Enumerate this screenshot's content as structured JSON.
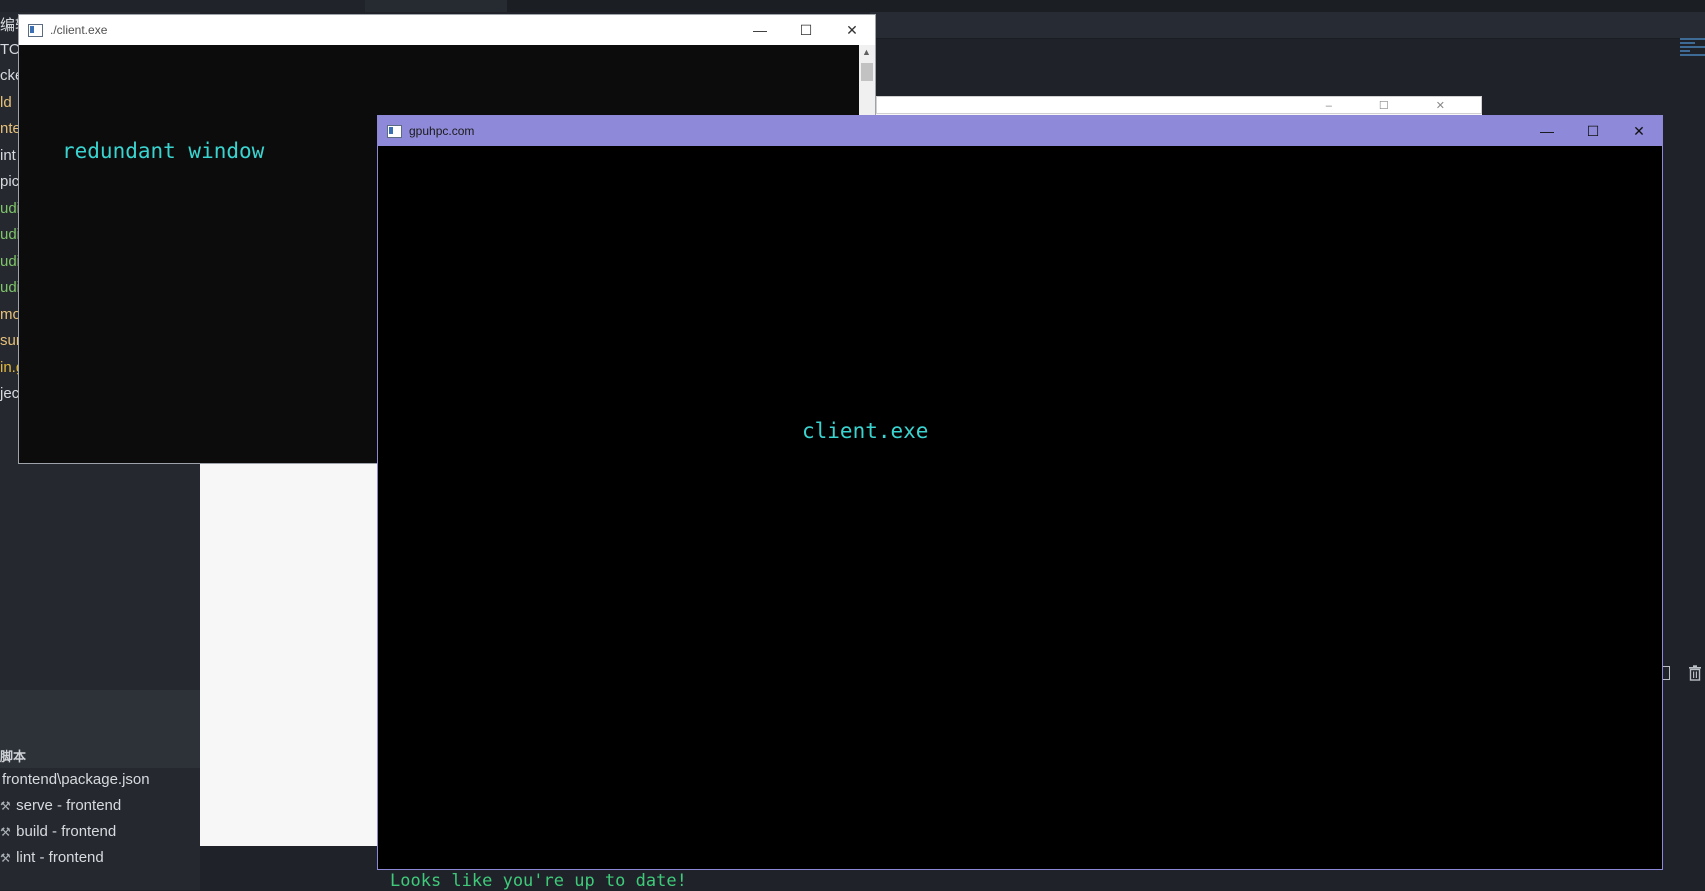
{
  "editor": {
    "sidebar_fragments": [
      {
        "text": "编辑",
        "color": "#d7dade"
      },
      {
        "text": "TOP",
        "color": "#d7dade"
      },
      {
        "text": "cke",
        "color": "#d7dade"
      },
      {
        "text": "ld",
        "color": "#e6c07b"
      },
      {
        "text": "nte",
        "color": "#e6c07b"
      },
      {
        "text": "int",
        "color": "#d7dade"
      },
      {
        "text": "pic",
        "color": "#d7dade"
      },
      {
        "text": "udi",
        "color": "#7fc46a"
      },
      {
        "text": "udi",
        "color": "#7fc46a"
      },
      {
        "text": "udi",
        "color": "#7fc46a"
      },
      {
        "text": "udi",
        "color": "#7fc46a"
      },
      {
        "text": "mo",
        "color": "#e6c07b"
      },
      {
        "text": "sur",
        "color": "#e6c07b"
      },
      {
        "text": "in.g",
        "color": "#e2b93b"
      },
      {
        "text": "jec",
        "color": "#d7dade"
      }
    ],
    "npm_scripts": {
      "title": "脚本",
      "file": "frontend\\package.json",
      "items": [
        "serve - frontend",
        "build - frontend",
        "lint - frontend"
      ]
    },
    "terminal_output": "Looks like you're up to date!",
    "icons": [
      "wrench-icon",
      "trash-icon",
      "split-terminal-icon"
    ]
  },
  "windows": {
    "redundant": {
      "title": "./client.exe",
      "content": "redundant window",
      "controls": {
        "minimize": "—",
        "maximize": "☐",
        "close": "✕"
      }
    },
    "main": {
      "title": "gpuhpc.com",
      "content": "client.exe",
      "controls": {
        "minimize": "—",
        "maximize": "☐",
        "close": "✕"
      },
      "title_color": "#8e89d8"
    }
  }
}
